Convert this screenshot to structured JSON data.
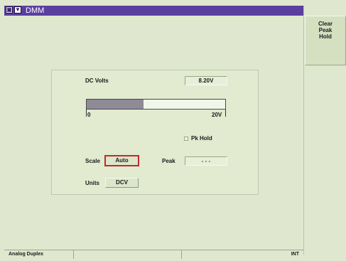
{
  "window": {
    "title": "DMM",
    "icons": [
      "window-menu-icon",
      "dropdown-icon"
    ]
  },
  "softkeys": [
    {
      "label": "Clear\nPeak\nHold"
    }
  ],
  "meter": {
    "measurement_label": "DC Volts",
    "reading": "8.20V",
    "bar": {
      "min_label": "0",
      "max_label": "20V",
      "fill_fraction": 0.41
    },
    "pk_hold_label": "Pk Hold",
    "pk_hold_checked": false,
    "scale_label": "Scale",
    "scale_value": "Auto",
    "peak_label": "Peak",
    "peak_value": "- - -",
    "units_label": "Units",
    "units_value": "DCV"
  },
  "statusbar": {
    "mode": "Analog Duplex",
    "cell2": "",
    "cell3": "",
    "source": "INT"
  },
  "colors": {
    "title_bar": "#5b3fa0",
    "background": "#dfe8cf",
    "bar_fill": "#8e8a96",
    "selected_outline": "#c02a2a"
  }
}
